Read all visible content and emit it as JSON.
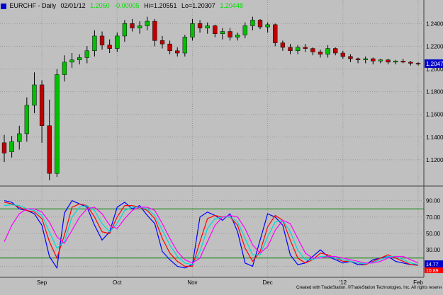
{
  "header": {
    "symbol_label": "EURCHF - Daily",
    "date": "02/01/12",
    "open_value": "1.2050",
    "change_value": "-0.00005",
    "high_label": "Hi=1.20551",
    "low_label": "Lo=1.20307",
    "close_value": "1.20448",
    "green_color": "#00dd00"
  },
  "footer": {
    "credit": "Created with TradeStation. ©TradeStation Technologies, Inc. All rights reserved."
  },
  "colors": {
    "background": "#c0c0c0",
    "grid": "#9a9a9a",
    "up_candle": "#00c000",
    "down_candle": "#c00000",
    "last_price_box": "#0000cc",
    "stoch_level": "#008000",
    "stoch_fast": "#0000ff",
    "stoch_red": "#ff0000",
    "stoch_cyan": "#00d8d8",
    "stoch_magenta": "#ff00ff"
  },
  "chart_data": [
    {
      "type": "candlestick",
      "title": "EURCHF - Daily",
      "last_price_label": "1.2047",
      "y_ticks": [
        "1.2400",
        "1.2200",
        "1.2000",
        "1.1800",
        "1.1600",
        "1.1400",
        "1.1200"
      ],
      "ylim": [
        1.1,
        1.252
      ],
      "x_labels": [
        {
          "label": "Sep",
          "index": 5
        },
        {
          "label": "Oct",
          "index": 15
        },
        {
          "label": "Nov",
          "index": 25
        },
        {
          "label": "Dec",
          "index": 35
        },
        {
          "label": "'12",
          "index": 45
        },
        {
          "label": "Feb",
          "index": 55
        }
      ],
      "grid": true,
      "ohlc": [
        [
          1.135,
          1.142,
          1.118,
          1.126
        ],
        [
          1.127,
          1.141,
          1.122,
          1.136
        ],
        [
          1.136,
          1.15,
          1.129,
          1.143
        ],
        [
          1.143,
          1.175,
          1.136,
          1.168
        ],
        [
          1.168,
          1.197,
          1.161,
          1.186
        ],
        [
          1.186,
          1.19,
          1.135,
          1.15
        ],
        [
          1.15,
          1.173,
          1.102,
          1.108
        ],
        [
          1.108,
          1.2,
          1.105,
          1.195
        ],
        [
          1.195,
          1.212,
          1.189,
          1.206
        ],
        [
          1.206,
          1.214,
          1.201,
          1.208
        ],
        [
          1.208,
          1.213,
          1.204,
          1.21
        ],
        [
          1.21,
          1.22,
          1.205,
          1.216
        ],
        [
          1.216,
          1.234,
          1.211,
          1.229
        ],
        [
          1.229,
          1.233,
          1.217,
          1.221
        ],
        [
          1.221,
          1.226,
          1.214,
          1.218
        ],
        [
          1.218,
          1.232,
          1.215,
          1.229
        ],
        [
          1.229,
          1.243,
          1.224,
          1.24
        ],
        [
          1.24,
          1.244,
          1.233,
          1.236
        ],
        [
          1.236,
          1.242,
          1.231,
          1.238
        ],
        [
          1.238,
          1.246,
          1.234,
          1.242
        ],
        [
          1.242,
          1.244,
          1.22,
          1.225
        ],
        [
          1.225,
          1.229,
          1.218,
          1.222
        ],
        [
          1.222,
          1.225,
          1.213,
          1.216
        ],
        [
          1.216,
          1.219,
          1.211,
          1.214
        ],
        [
          1.214,
          1.23,
          1.211,
          1.228
        ],
        [
          1.228,
          1.244,
          1.225,
          1.24
        ],
        [
          1.24,
          1.243,
          1.232,
          1.236
        ],
        [
          1.236,
          1.241,
          1.231,
          1.238
        ],
        [
          1.238,
          1.239,
          1.228,
          1.231
        ],
        [
          1.231,
          1.236,
          1.226,
          1.233
        ],
        [
          1.233,
          1.236,
          1.225,
          1.228
        ],
        [
          1.228,
          1.232,
          1.225,
          1.23
        ],
        [
          1.23,
          1.241,
          1.227,
          1.238
        ],
        [
          1.238,
          1.246,
          1.234,
          1.243
        ],
        [
          1.243,
          1.244,
          1.235,
          1.237
        ],
        [
          1.237,
          1.241,
          1.232,
          1.239
        ],
        [
          1.239,
          1.24,
          1.22,
          1.223
        ],
        [
          1.223,
          1.225,
          1.216,
          1.219
        ],
        [
          1.219,
          1.222,
          1.213,
          1.216
        ],
        [
          1.216,
          1.221,
          1.213,
          1.219
        ],
        [
          1.219,
          1.222,
          1.215,
          1.218
        ],
        [
          1.218,
          1.219,
          1.212,
          1.215
        ],
        [
          1.215,
          1.217,
          1.21,
          1.213
        ],
        [
          1.213,
          1.221,
          1.21,
          1.218
        ],
        [
          1.218,
          1.219,
          1.212,
          1.214
        ],
        [
          1.214,
          1.216,
          1.209,
          1.211
        ],
        [
          1.211,
          1.213,
          1.206,
          1.209
        ],
        [
          1.209,
          1.21,
          1.205,
          1.208
        ],
        [
          1.208,
          1.211,
          1.205,
          1.209
        ],
        [
          1.209,
          1.21,
          1.204,
          1.207
        ],
        [
          1.207,
          1.209,
          1.205,
          1.208
        ],
        [
          1.208,
          1.209,
          1.204,
          1.206
        ],
        [
          1.206,
          1.208,
          1.204,
          1.207
        ],
        [
          1.207,
          1.209,
          1.205,
          1.206
        ],
        [
          1.206,
          1.207,
          1.203,
          1.205
        ],
        [
          1.205,
          1.206,
          1.203,
          1.2047
        ]
      ]
    },
    {
      "type": "line",
      "title": "",
      "y_ticks": [
        "90.00",
        "70.00",
        "50.00",
        "30.00",
        "10.00"
      ],
      "ylim": [
        0,
        100
      ],
      "levels": [
        80,
        20
      ],
      "value_labels": [
        "14.77",
        "10.89"
      ],
      "series": [
        {
          "color": "#0000ff",
          "values": [
            90,
            88,
            80,
            78,
            74,
            60,
            22,
            8,
            75,
            90,
            86,
            82,
            60,
            42,
            52,
            82,
            88,
            80,
            84,
            72,
            62,
            28,
            18,
            10,
            8,
            12,
            70,
            76,
            72,
            66,
            74,
            52,
            14,
            10,
            42,
            74,
            70,
            60,
            24,
            12,
            14,
            22,
            30,
            22,
            18,
            14,
            16,
            12,
            12,
            18,
            20,
            22,
            16,
            14,
            12,
            12
          ]
        },
        {
          "color": "#ff0000",
          "values": [
            88,
            86,
            82,
            78,
            76,
            68,
            40,
            20,
            48,
            82,
            86,
            84,
            70,
            52,
            50,
            70,
            84,
            84,
            82,
            78,
            68,
            44,
            26,
            16,
            10,
            10,
            40,
            68,
            72,
            70,
            70,
            60,
            32,
            16,
            28,
            58,
            72,
            66,
            42,
            20,
            14,
            18,
            26,
            24,
            20,
            16,
            16,
            14,
            12,
            16,
            20,
            24,
            20,
            16,
            12,
            11
          ]
        },
        {
          "color": "#00d8d8",
          "values": [
            84,
            85,
            84,
            80,
            78,
            72,
            52,
            32,
            40,
            70,
            82,
            84,
            78,
            62,
            52,
            62,
            78,
            82,
            82,
            80,
            72,
            54,
            36,
            22,
            14,
            12,
            28,
            56,
            68,
            70,
            70,
            64,
            44,
            24,
            24,
            46,
            64,
            66,
            52,
            30,
            18,
            18,
            22,
            22,
            20,
            18,
            16,
            14,
            13,
            15,
            18,
            22,
            22,
            18,
            14,
            12
          ]
        },
        {
          "color": "#ff00ff",
          "values": [
            40,
            60,
            74,
            80,
            80,
            76,
            64,
            46,
            38,
            54,
            70,
            80,
            82,
            74,
            60,
            56,
            68,
            78,
            82,
            82,
            78,
            62,
            44,
            28,
            18,
            14,
            20,
            40,
            60,
            70,
            72,
            70,
            56,
            36,
            26,
            34,
            54,
            66,
            62,
            44,
            26,
            20,
            20,
            22,
            22,
            20,
            18,
            16,
            14,
            14,
            16,
            20,
            22,
            22,
            18,
            14
          ]
        }
      ]
    }
  ]
}
